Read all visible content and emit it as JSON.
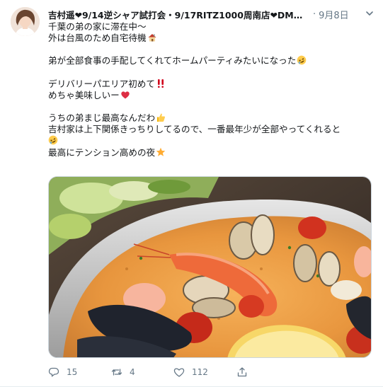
{
  "tweet": {
    "author_name": "吉村遥❤9/14逆シャア試打会・9/17RITZ1000周南店❤DMM...",
    "separator": "·",
    "timestamp": "9月8日",
    "lines": [
      "千葉の弟の家に滞在中〜",
      "外は台風のため自宅待機",
      "",
      "弟が全部食事の手配してくれてホームパーティみたいになった",
      "",
      "デリバリーパエリア初めて",
      "めちゃ美味しいー",
      "",
      "うちの弟まじ最高なんだわ",
      "吉村家は上下関係きっちりしてるので、一番最年少が全部やってくれると",
      "",
      "最高にテンション高めの夜"
    ],
    "emoji_icons": {
      "house": "house-icon",
      "rofl": "rolling-laughing-icon",
      "double_exclamation": "double-exclamation-icon",
      "heart": "red-heart-icon",
      "thumbs_up": "thumbs-up-icon",
      "star": "glowing-star-icon"
    },
    "media_alt_icon": "paella-photo",
    "actions": {
      "reply_count": "15",
      "retweet_count": "4",
      "like_count": "112",
      "share_label": ""
    },
    "colors": {
      "text": "#14171a",
      "muted": "#657786",
      "heart": "#e0245e",
      "exclaim": "#d0021b"
    }
  }
}
